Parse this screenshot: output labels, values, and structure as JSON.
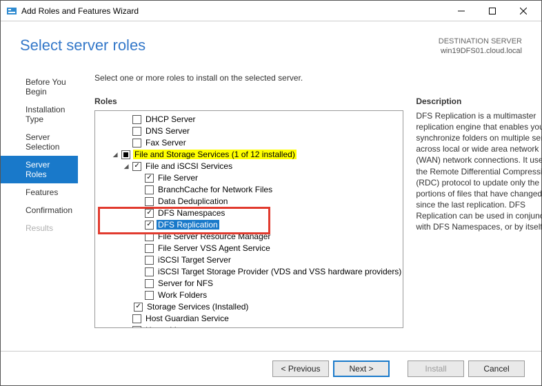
{
  "window": {
    "title": "Add Roles and Features Wizard"
  },
  "header": {
    "title": "Select server roles",
    "destination_label": "DESTINATION SERVER",
    "destination_value": "win19DFS01.cloud.local"
  },
  "sidebar": {
    "items": [
      {
        "label": "Before You Begin",
        "active": false
      },
      {
        "label": "Installation Type",
        "active": false
      },
      {
        "label": "Server Selection",
        "active": false
      },
      {
        "label": "Server Roles",
        "active": true
      },
      {
        "label": "Features",
        "active": false
      },
      {
        "label": "Confirmation",
        "active": false
      },
      {
        "label": "Results",
        "active": false,
        "disabled": true
      }
    ]
  },
  "main": {
    "instruction": "Select one or more roles to install on the selected server.",
    "roles_label": "Roles",
    "description_label": "Description",
    "description_text": "DFS Replication is a multimaster replication engine that enables you to synchronize folders on multiple servers across local or wide area network (WAN) network connections. It uses the Remote Differential Compression (RDC) protocol to update only the portions of files that have changed since the last replication. DFS Replication can be used in conjunction with DFS Namespaces, or by itself."
  },
  "roles_tree": {
    "r0": {
      "label": "DHCP Server"
    },
    "r1": {
      "label": "DNS Server"
    },
    "r2": {
      "label": "Fax Server"
    },
    "r3": {
      "label": "File and Storage Services (1 of 12 installed)"
    },
    "r4": {
      "label": "File and iSCSI Services"
    },
    "r5": {
      "label": "File Server"
    },
    "r6": {
      "label": "BranchCache for Network Files"
    },
    "r7": {
      "label": "Data Deduplication"
    },
    "r8": {
      "label": "DFS Namespaces"
    },
    "r9": {
      "label": "DFS Replication"
    },
    "r10": {
      "label": "File Server Resource Manager"
    },
    "r11": {
      "label": "File Server VSS Agent Service"
    },
    "r12": {
      "label": "iSCSI Target Server"
    },
    "r13": {
      "label": "iSCSI Target Storage Provider (VDS and VSS hardware providers)"
    },
    "r14": {
      "label": "Server for NFS"
    },
    "r15": {
      "label": "Work Folders"
    },
    "r16": {
      "label": "Storage Services (Installed)"
    },
    "r17": {
      "label": "Host Guardian Service"
    },
    "r18": {
      "label": "Hyper-V"
    }
  },
  "footer": {
    "previous": "< Previous",
    "next": "Next >",
    "install": "Install",
    "cancel": "Cancel"
  }
}
